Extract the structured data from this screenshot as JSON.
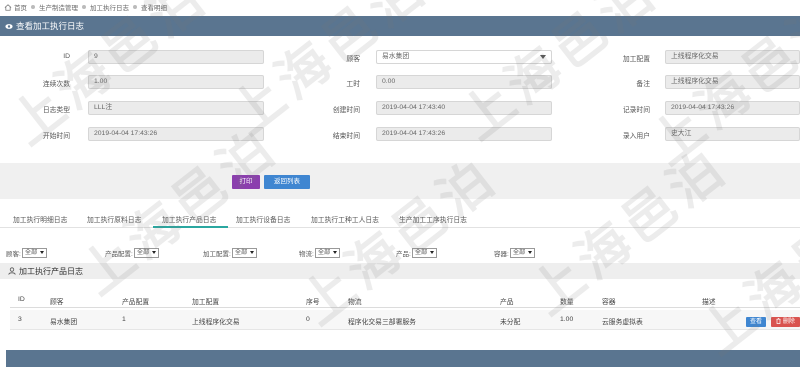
{
  "breadcrumb": {
    "items": [
      "首页",
      "生产制造管理",
      "加工执行日志",
      "查看明细"
    ]
  },
  "panel": {
    "title": "查看加工执行日志"
  },
  "form": {
    "fields": [
      {
        "label": "ID",
        "value": "9"
      },
      {
        "label": "顾客",
        "value": "易水集团"
      },
      {
        "label": "加工配置",
        "value": "上线程序化交易"
      },
      {
        "label": "连续次数",
        "value": "1.00"
      },
      {
        "label": "工时",
        "value": "0.00"
      },
      {
        "label": "备注",
        "value": "上线程序化交易"
      },
      {
        "label": "日志类型",
        "value": "LLL注"
      },
      {
        "label": "创建时间",
        "value": "2019-04-04 17:43:40"
      },
      {
        "label": "记录时间",
        "value": "2019-04-04 17:43:26"
      },
      {
        "label": "开始时间",
        "value": "2019-04-04 17:43:26"
      },
      {
        "label": "结束时间",
        "value": "2019-04-04 17:43:26"
      },
      {
        "label": "录入用户",
        "value": "史大江"
      }
    ]
  },
  "actions": {
    "print_label": "打印",
    "back_label": "返回列表"
  },
  "tabs": [
    {
      "label": "加工执行明细日志"
    },
    {
      "label": "加工执行原料日志"
    },
    {
      "label": "加工执行产品日志"
    },
    {
      "label": "加工执行设备日志"
    },
    {
      "label": "加工执行工种工人日志"
    },
    {
      "label": "生产加工工序执行日志"
    }
  ],
  "filters": [
    {
      "label": "顾客:",
      "value": "全部"
    },
    {
      "label": "产品配置:",
      "value": "全部"
    },
    {
      "label": "加工配置:",
      "value": "全部"
    },
    {
      "label": "物流:",
      "value": "全部"
    },
    {
      "label": "产品:",
      "value": "全部"
    },
    {
      "label": "容器:",
      "value": "全部"
    }
  ],
  "section": {
    "title": "加工执行产品日志"
  },
  "table": {
    "columns": [
      "ID",
      "顾客",
      "产品配置",
      "加工配置",
      "序号",
      "物流",
      "产品",
      "数量",
      "容器",
      "描述"
    ],
    "rows": [
      [
        "3",
        "易水集团",
        "1",
        "上线程序化交易",
        "0",
        "程序化交易三部署服务",
        "未分配",
        "1.00",
        "云服务虚拟表",
        ""
      ]
    ],
    "row_actions": {
      "view_label": "查看",
      "delete_label": "删除"
    }
  },
  "watermark": {
    "text": "上海邑泊"
  },
  "colors": {
    "header_bg": "#5a7590",
    "print_btn": "#8b3fae",
    "back_btn": "#3f86d1",
    "delete_btn": "#d9534f",
    "tab_accent": "#2aa7a0"
  }
}
